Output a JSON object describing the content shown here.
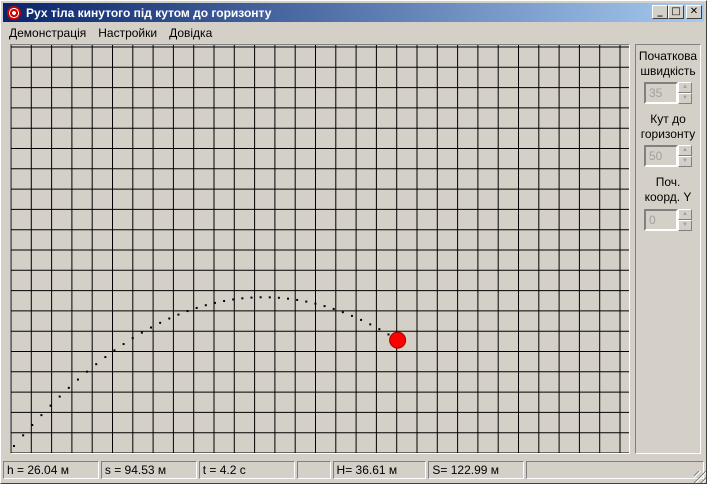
{
  "window": {
    "title": "Рух тіла кинутого під кутом до горизонту",
    "buttons": {
      "minimize": "_",
      "maximize": "□",
      "close": "✕"
    }
  },
  "menu": [
    "Демонстрація",
    "Настройки",
    "Довідка"
  ],
  "controls": [
    {
      "label1": "Початкова",
      "label2": "швидкість",
      "value": "35"
    },
    {
      "label1": "Кут до",
      "label2": "горизонту",
      "value": "50"
    },
    {
      "label1": "Поч.",
      "label2": "коорд. Y",
      "value": "0"
    }
  ],
  "status": {
    "h": "h =  26.04 м",
    "s": "s =  94.53 м",
    "t": "t =  4.2 с",
    "empty": "",
    "H": "H=  36.61 м",
    "S": "S=  122.99 м",
    "extra": ""
  },
  "simulation": {
    "v0_mps": 35,
    "angle_deg": 50,
    "y0_m": 0,
    "g_mps2": 9.81,
    "current_time_s": 4.2,
    "trail_dt_s": 0.1,
    "grid_cell_m": 5,
    "trail_color": "#000000",
    "ball_color": "#ff0000",
    "grid_color": "#000000"
  }
}
